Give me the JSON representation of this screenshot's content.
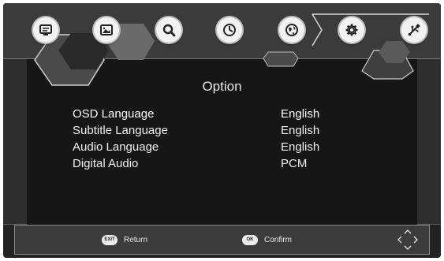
{
  "menu": {
    "icons": [
      {
        "name": "tv-icon"
      },
      {
        "name": "picture-icon"
      },
      {
        "name": "search-icon"
      },
      {
        "name": "clock-icon"
      },
      {
        "name": "globe-icon"
      },
      {
        "name": "gear-icon"
      },
      {
        "name": "usb-icon"
      }
    ],
    "selected": "globe-icon"
  },
  "page": {
    "title": "Option",
    "rows": [
      {
        "label": "OSD Language",
        "value": "English"
      },
      {
        "label": "Subtitle Language",
        "value": "English"
      },
      {
        "label": "Audio Language",
        "value": "English"
      },
      {
        "label": "Digital Audio",
        "value": "PCM"
      }
    ]
  },
  "footer": {
    "exit_key": "EXIT",
    "return_label": "Return",
    "ok_key": "OK",
    "confirm_label": "Confirm"
  }
}
